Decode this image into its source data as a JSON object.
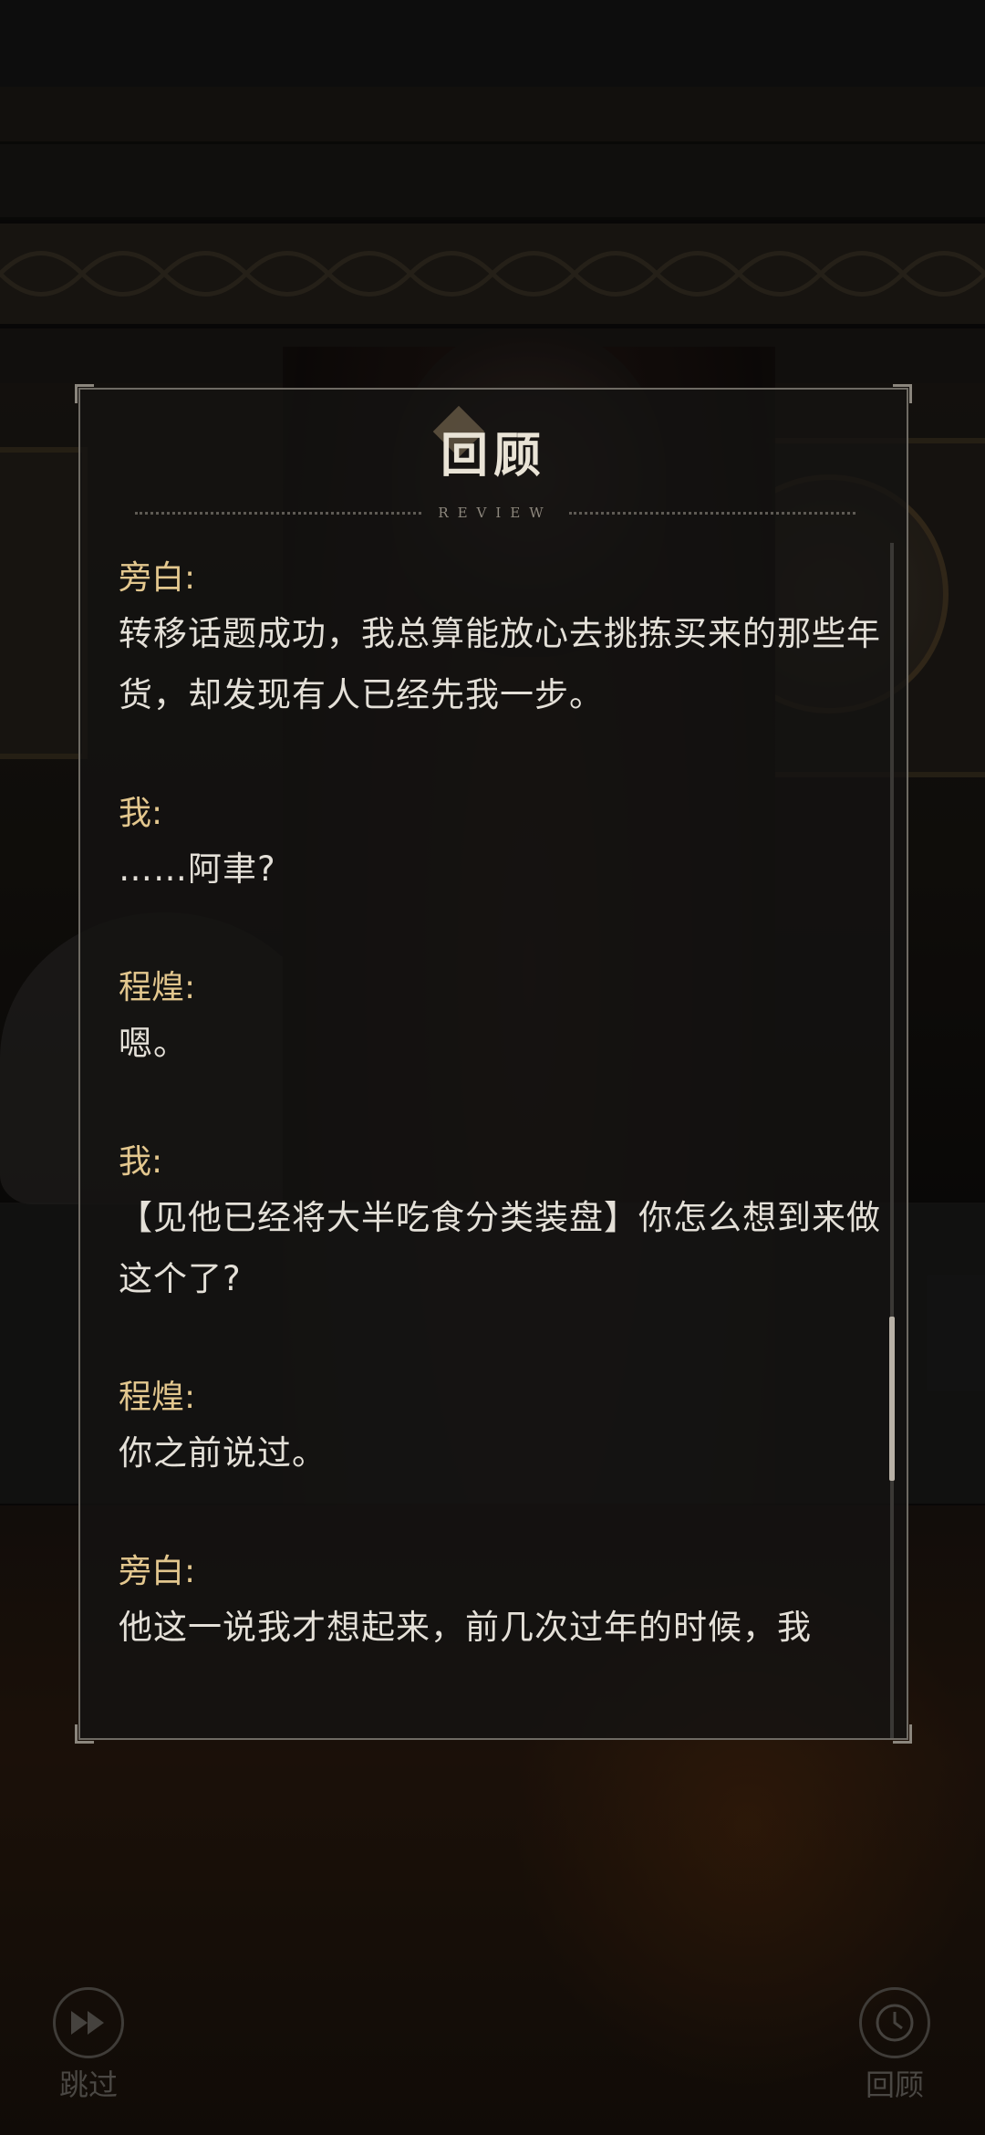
{
  "review_panel": {
    "title": "回顾",
    "subtitle": "REVIEW",
    "entries": [
      {
        "speaker": "旁白:",
        "text": "转移话题成功，我总算能放心去挑拣买来的那些年货，却发现有人已经先我一步。"
      },
      {
        "speaker": "我:",
        "text": "……阿聿?"
      },
      {
        "speaker": "程煌:",
        "text": "嗯。"
      },
      {
        "speaker": "我:",
        "text": "【见他已经将大半吃食分类装盘】你怎么想到来做这个了?"
      },
      {
        "speaker": "程煌:",
        "text": "你之前说过。"
      },
      {
        "speaker": "旁白:",
        "text": "他这一说我才想起来，前几次过年的时候，我"
      }
    ],
    "scroll_position": 0.75
  },
  "controls": {
    "skip_label": "跳过",
    "review_label": "回顾"
  },
  "colors": {
    "speaker": "#e3c78e",
    "text": "#e4e0d8",
    "panel_border": "#6e6a63"
  }
}
